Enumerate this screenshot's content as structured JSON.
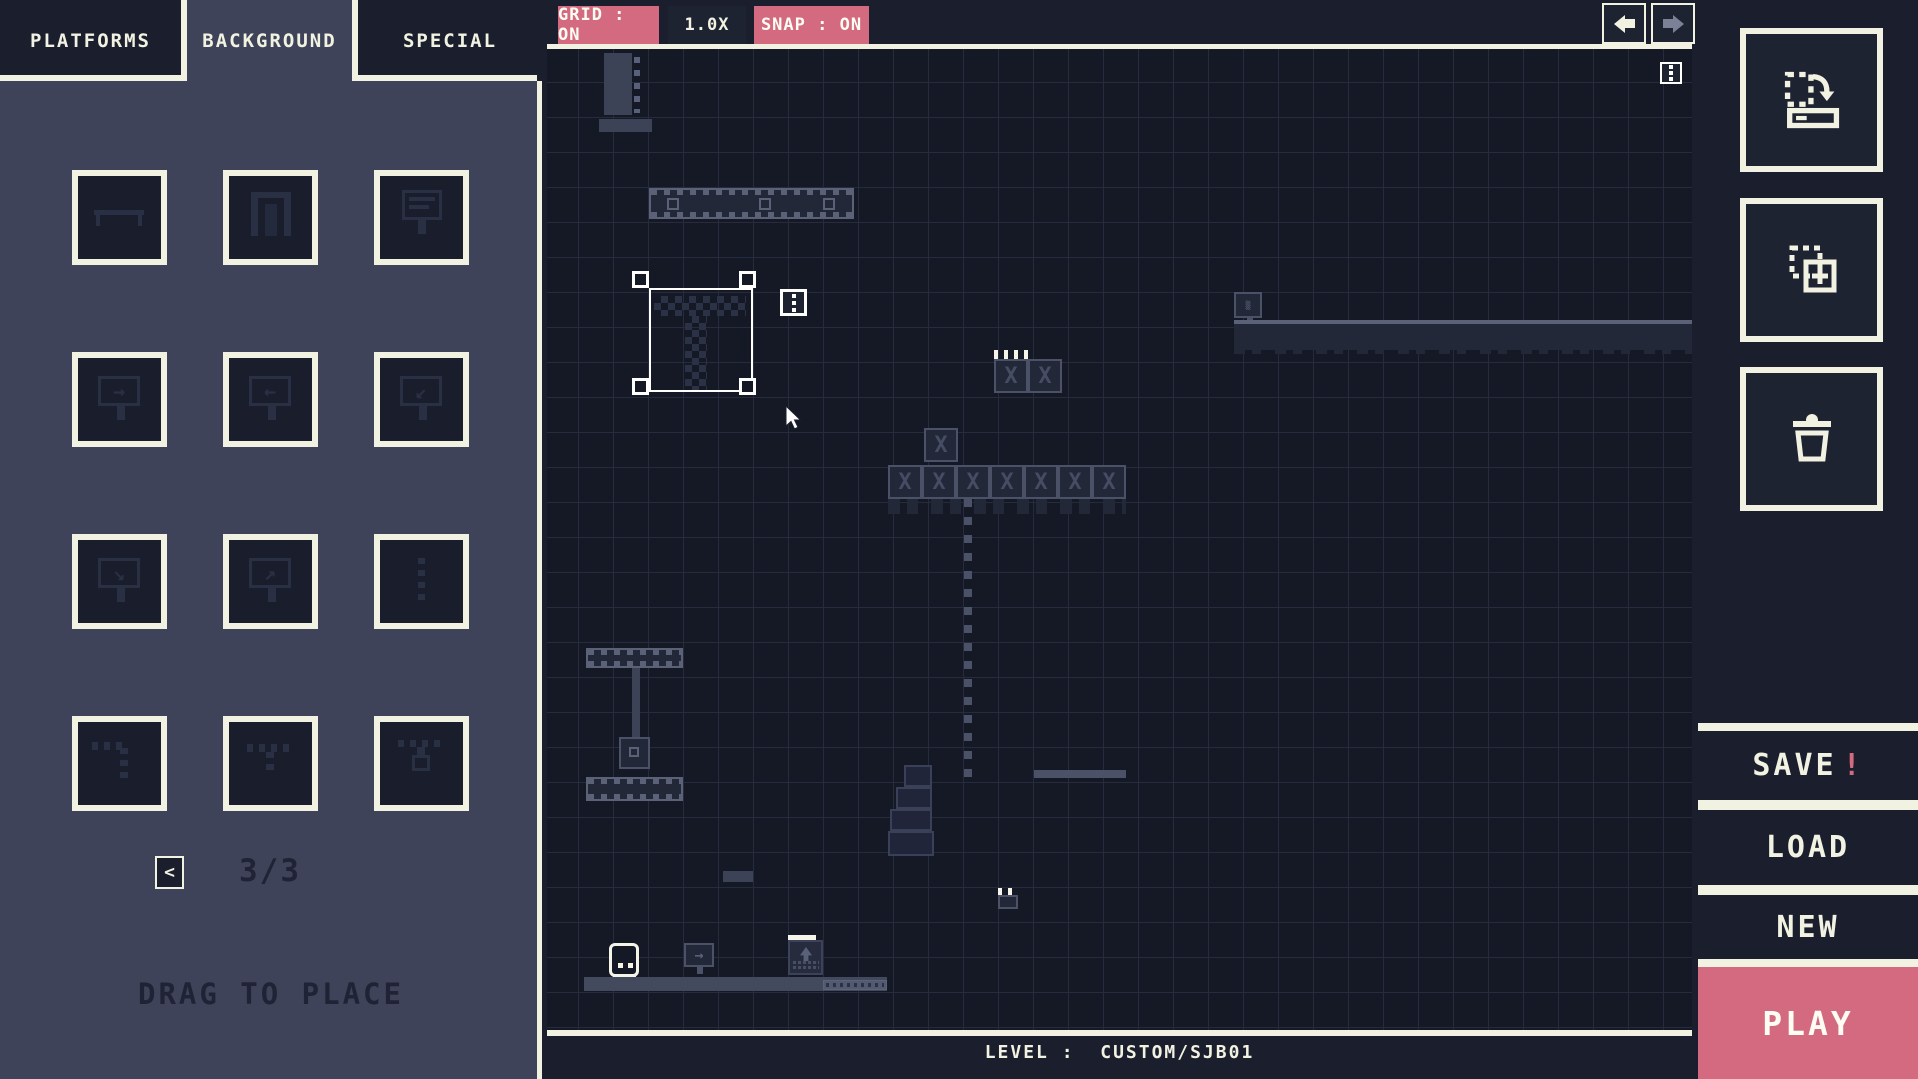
{
  "sidebar": {
    "tabs": [
      {
        "label": "PLATFORMS",
        "active": false
      },
      {
        "label": "BACKGROUND",
        "active": true
      },
      {
        "label": "SPECIAL",
        "active": false
      }
    ],
    "palette_tiles": [
      {
        "name": "beam-platform"
      },
      {
        "name": "doorway"
      },
      {
        "name": "billboard-sign"
      },
      {
        "name": "sign-arrow-right"
      },
      {
        "name": "sign-arrow-left"
      },
      {
        "name": "sign-arrow-down-left"
      },
      {
        "name": "sign-arrow-down-right"
      },
      {
        "name": "sign-arrow-up-right"
      },
      {
        "name": "vertical-chain"
      },
      {
        "name": "pipe-corner"
      },
      {
        "name": "pipe-tee"
      },
      {
        "name": "hanging-grabber"
      }
    ],
    "pager": {
      "prev": "<",
      "indicator": "3/3"
    },
    "hint": "DRAG TO PLACE"
  },
  "toolbar": {
    "grid": "GRID : ON",
    "zoom": "1.0X",
    "snap": "SNAP : ON"
  },
  "right_panel": {
    "save": "SAVE",
    "save_alert": "!",
    "load": "LOAD",
    "new": "NEW",
    "play": "PLAY"
  },
  "status_bar": {
    "level": "LEVEL :  CUSTOM/SJB01"
  },
  "colors": {
    "accent_pink": "#d46a80",
    "cream": "#f1f2e1",
    "panel_navy": "#1a1e2d",
    "sidebar_slate": "#3e4359",
    "canvas_bg": "#151926"
  }
}
